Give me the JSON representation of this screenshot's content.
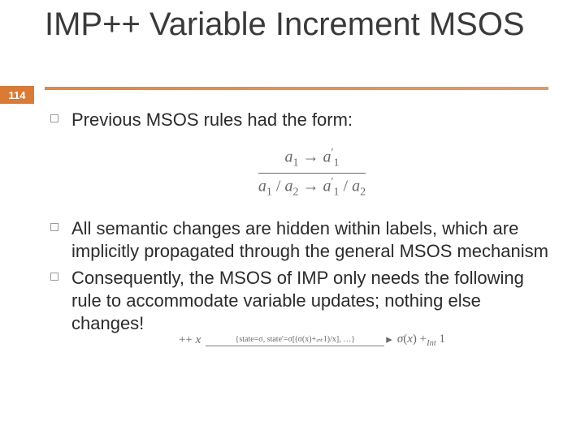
{
  "slide_number": "114",
  "title": "IMP++ Variable Increment MSOS",
  "bullets": {
    "b1": "Previous MSOS rules had the form:",
    "b2": "All semantic changes are hidden within labels, which are implicitly propagated through the general MSOS mechanism",
    "b3": "Consequently, the MSOS of IMP only needs the following rule to accommodate variable updates; nothing else changes!"
  },
  "formula1": {
    "numerator": "a₁ → a₁′",
    "denominator": "a₁ / a₂ → a₁′ / a₂"
  },
  "formula2": {
    "label_top": "{state=σ, state'=σ[(σ(x)+ᵢₙₜ1)/x], …}",
    "left": "++ x",
    "arrow": "→",
    "right": "σ(x) +ₗₙₜ 1",
    "right_plain": "σ(x) +Int 1"
  }
}
